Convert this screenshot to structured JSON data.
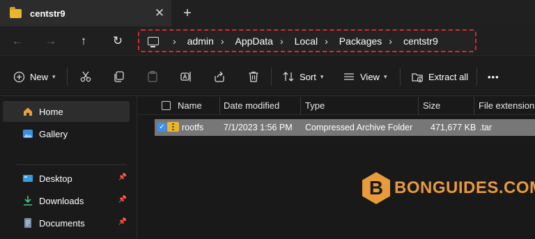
{
  "tab": {
    "title": "centstr9",
    "close_glyph": "✕",
    "new_tab_glyph": "+"
  },
  "nav": {
    "back": "←",
    "forward": "→",
    "up": "↑",
    "refresh": "↻",
    "breadcrumbs": [
      "admin",
      "AppData",
      "Local",
      "Packages",
      "centstr9"
    ],
    "separator": "›"
  },
  "commands": {
    "new_label": "New",
    "sort_label": "Sort",
    "view_label": "View",
    "extract_label": "Extract all",
    "more": "•••"
  },
  "sidebar": {
    "items": [
      {
        "label": "Home",
        "icon": "home-icon"
      },
      {
        "label": "Gallery",
        "icon": "gallery-icon"
      },
      {
        "label": "Desktop",
        "icon": "desktop-icon"
      },
      {
        "label": "Downloads",
        "icon": "download-icon"
      },
      {
        "label": "Documents",
        "icon": "documents-icon"
      }
    ]
  },
  "columns": [
    "Name",
    "Date modified",
    "Type",
    "Size",
    "File extension"
  ],
  "rows": [
    {
      "name": "rootfs",
      "date": "7/1/2023 1:56 PM",
      "type": "Compressed Archive Folder",
      "size": "471,677 KB",
      "ext": ".tar"
    }
  ],
  "watermark": {
    "letter": "B",
    "text": "BONGUIDES.COM"
  },
  "colors": {
    "accent": "#3e8ff0",
    "highlight_border": "#e0282e",
    "watermark": "#e89a3c",
    "folder": "#e8b62e"
  }
}
